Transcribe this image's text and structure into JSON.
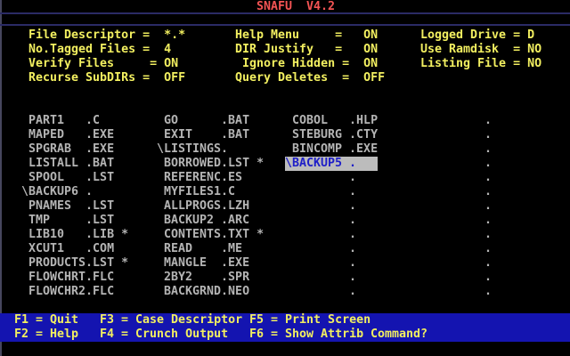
{
  "title": "SNAFU  V4.2",
  "colors": {
    "title_red": "#f45454",
    "text_yellow": "#f2ef60",
    "file_gray": "#b4b4b4",
    "highlight_bg": "#bcbcbc",
    "highlight_fg": "#1e1ec8",
    "footer_bg": "#1414b0",
    "edge_line": "#46465e",
    "separator_line": "#2b2b66"
  },
  "settings": {
    "left": [
      "File Descriptor =  *.*",
      "No.Tagged Files =  4",
      "Verify Files     = ON",
      "Recurse SubDIRs =  OFF"
    ],
    "middle": [
      "Help Menu     =   ON",
      "DIR Justify   =   ON",
      " Ignore Hidden =  ON",
      "Query Deletes  =  OFF"
    ],
    "right": [
      "Logged Drive = D",
      "Use Ramdisk  = NO",
      "Listing File = NO"
    ]
  },
  "files": {
    "columns": [
      {
        "rows": [
          {
            "text": " PART1   .C"
          },
          {
            "text": " MAPED   .EXE"
          },
          {
            "text": " SPGRAB  .EXE"
          },
          {
            "text": " LISTALL .BAT"
          },
          {
            "text": " SPOOL   .LST"
          },
          {
            "text": "\\BACKUP6 ."
          },
          {
            "text": " PNAMES  .LST"
          },
          {
            "text": " TMP     .LST"
          },
          {
            "text": " LIB10   .LIB *"
          },
          {
            "text": " XCUT1   .COM"
          },
          {
            "text": " PRODUCTS.LST *"
          },
          {
            "text": " FLOWCHRT.FLC"
          },
          {
            "text": " FLOWCHR2.FLC"
          }
        ]
      },
      {
        "rows": [
          {
            "text": " GO      .BAT"
          },
          {
            "text": " EXIT    .BAT"
          },
          {
            "text": "\\LISTINGS."
          },
          {
            "text": " BORROWED.LST *"
          },
          {
            "text": " REFERENC.ES"
          },
          {
            "text": " MYFILES1.C"
          },
          {
            "text": " ALLPROGS.LZH"
          },
          {
            "text": " BACKUP2 .ARC"
          },
          {
            "text": " CONTENTS.TXT *"
          },
          {
            "text": " READ    .ME"
          },
          {
            "text": " MANGLE  .EXE"
          },
          {
            "text": " 2BY2    .SPR"
          },
          {
            "text": " BACKGRND.NEO"
          }
        ]
      },
      {
        "rows": [
          {
            "text": " COBOL   .HLP"
          },
          {
            "text": " STEBURG .CTY"
          },
          {
            "text": " BINCOMP .EXE"
          },
          {
            "text": "\\BACKUP5 .   ",
            "selected": true
          },
          {
            "text": "         ."
          },
          {
            "text": "         ."
          },
          {
            "text": "         ."
          },
          {
            "text": "         ."
          },
          {
            "text": "         ."
          },
          {
            "text": "         ."
          },
          {
            "text": "         ."
          },
          {
            "text": "         ."
          },
          {
            "text": "         ."
          }
        ]
      },
      {
        "rows": [
          {
            "text": "         ."
          },
          {
            "text": "         ."
          },
          {
            "text": "         ."
          },
          {
            "text": "         ."
          },
          {
            "text": "         ."
          },
          {
            "text": "         ."
          },
          {
            "text": "         ."
          },
          {
            "text": "         ."
          },
          {
            "text": "         ."
          },
          {
            "text": "         ."
          },
          {
            "text": "         ."
          },
          {
            "text": "         ."
          },
          {
            "text": "         ."
          }
        ]
      }
    ]
  },
  "footer": {
    "row1": [
      "F1 = Quit",
      "F3 = Case Descriptor",
      "F5 = Print Screen"
    ],
    "row2": [
      "F2 = Help",
      "F4 = Crunch Output",
      "F6 = Show Attrib"
    ],
    "command_prompt": "Command?"
  }
}
